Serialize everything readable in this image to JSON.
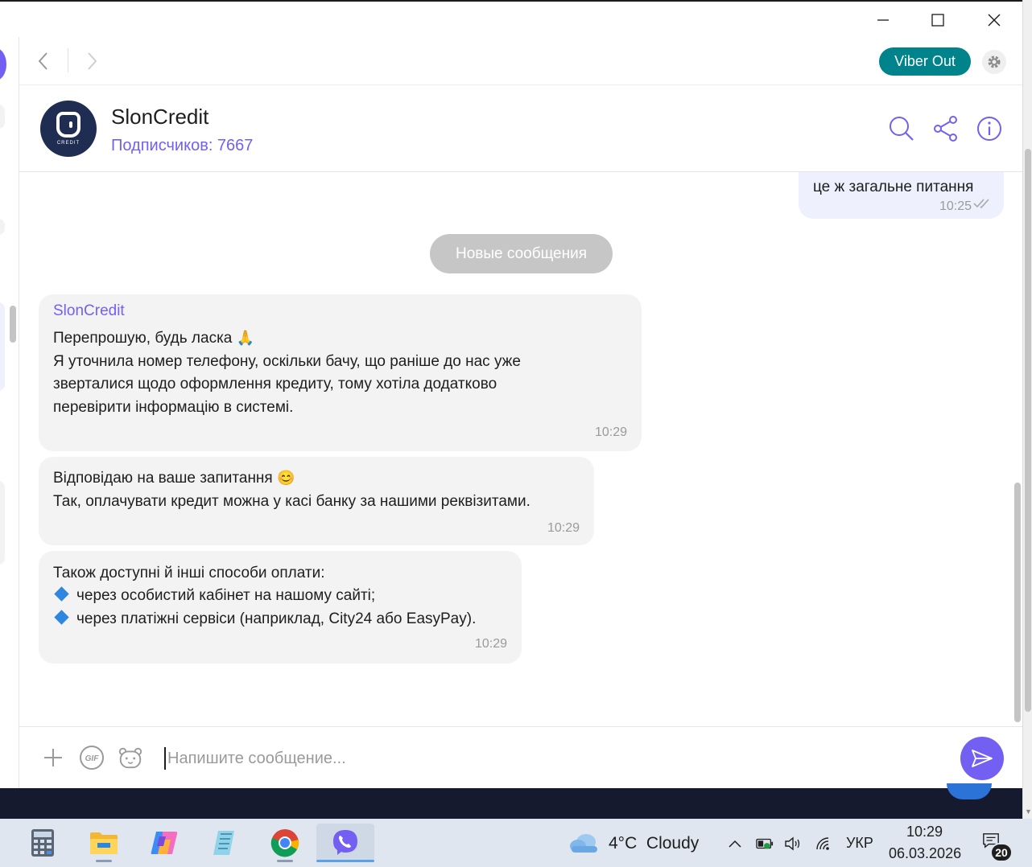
{
  "nav": {
    "viber_out_label": "Viber Out"
  },
  "chat": {
    "name": "SlonCredit",
    "subscribers": "Подписчиков: 7667",
    "avatar_text": "CREDIT"
  },
  "messages": {
    "outgoing": {
      "text": "це ж загальне питання",
      "time": "10:25"
    },
    "new_messages_label": "Новые сообщения",
    "incoming": [
      {
        "sender": "SlonCredit",
        "lines": [
          "Перепрошую, будь ласка",
          "Я уточнила номер телефону, оскільки бачу, що раніше до нас уже",
          "зверталися щодо оформлення кредиту, тому хотіла додатково",
          "перевірити інформацію в системі."
        ],
        "emoji": "🙏",
        "time": "10:29"
      },
      {
        "lines": [
          "Відповідаю на ваше запитання",
          "Так, оплачувати кредит можна у касі банку за нашими реквізитами."
        ],
        "emoji": "😊",
        "time": "10:29"
      },
      {
        "lines": [
          "Також доступні й інші способи оплати:",
          "через особистий кабінет на нашому сайті;",
          "через платіжні сервіси (наприклад, City24 або EasyPay)."
        ],
        "time": "10:29"
      }
    ]
  },
  "composer": {
    "placeholder": "Напишите сообщение...",
    "gif_label": "GIF"
  },
  "taskbar": {
    "weather_temp": "4°C",
    "weather_cond": "Cloudy",
    "language": "УКР",
    "time": "10:29",
    "date": "06.03.2026",
    "notification_count": "20"
  },
  "colors": {
    "accent": "#7360f2",
    "viber_out": "#00838a",
    "bubble_in": "#f3f3f3",
    "bubble_out": "#eef1fd"
  }
}
